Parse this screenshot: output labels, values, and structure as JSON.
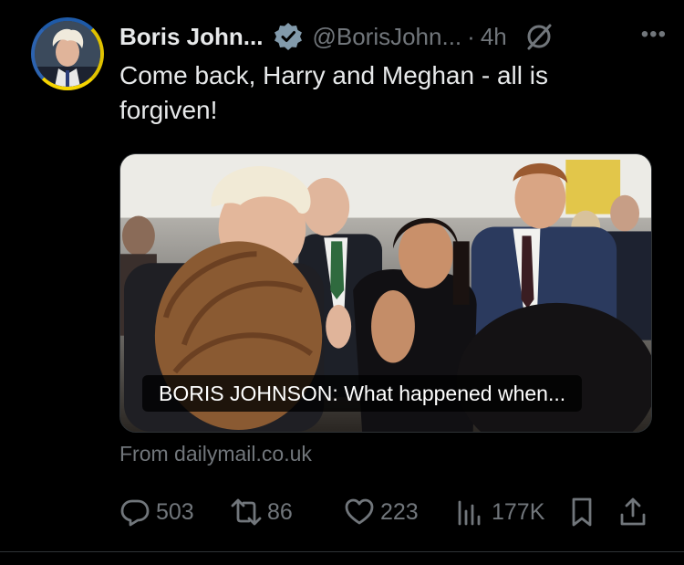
{
  "tweet": {
    "author_name": "Boris John...",
    "handle": "@BorisJohn...",
    "separator": "·",
    "time": "4h",
    "more": "•••",
    "text": "Come back, Harry and Meghan - all is forgiven!"
  },
  "card": {
    "caption": "BORIS JOHNSON: What happened when...",
    "source": "From dailymail.co.uk"
  },
  "actions": {
    "replies": "503",
    "reposts": "86",
    "likes": "223",
    "views": "177K"
  },
  "colors": {
    "background": "#000000",
    "text": "#e7e9ea",
    "muted": "#71767b",
    "verified": "#829aab",
    "avatar_ring_blue": "#1e5aa8",
    "avatar_ring_yellow": "#f5d400",
    "divider": "#2f3336"
  },
  "icons": {
    "verified": "verified-badge-icon",
    "grok": "grok-icon",
    "reply": "reply-icon",
    "repost": "repost-icon",
    "like": "heart-icon",
    "views": "views-chart-icon",
    "bookmark": "bookmark-icon",
    "share": "share-icon"
  }
}
